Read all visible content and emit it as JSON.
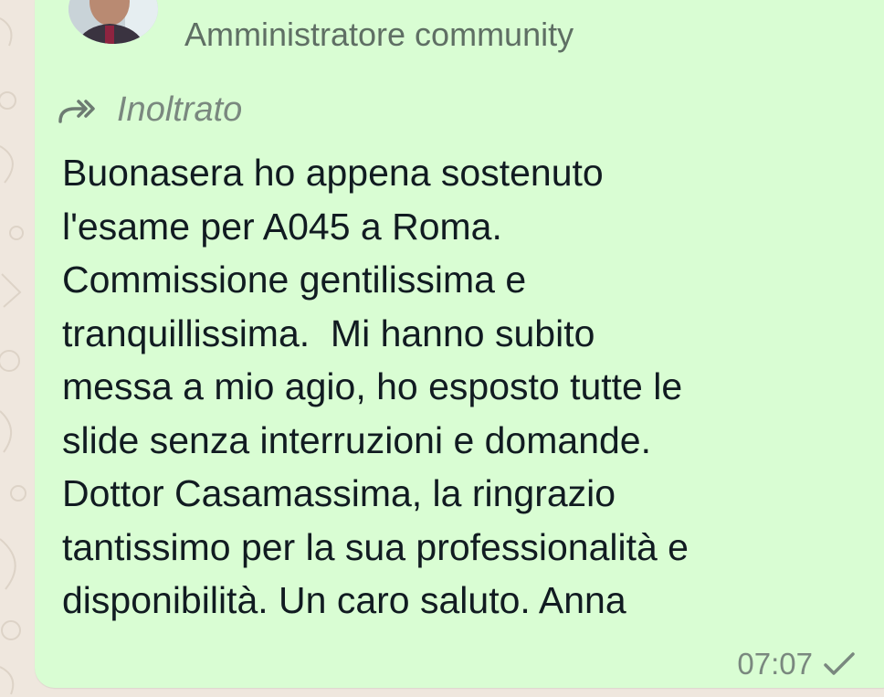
{
  "message": {
    "sender": "Amministratore community",
    "forwarded_label": "Inoltrato",
    "text_lines": [
      "Buonasera ho appena sostenuto",
      "l'esame per A045 a Roma.",
      "Commissione gentilissima e",
      "tranquillissima.  Mi hanno subito",
      "messa a mio agio, ho esposto tutte le",
      "slide senza interruzioni e domande.",
      "Dottor Casamassima, la ringrazio",
      "tantissimo per la sua professionalità e",
      "disponibilità. Un caro saluto. Anna"
    ],
    "time": "07:07",
    "status_icon": "single-check-icon"
  },
  "colors": {
    "bubble": "#d9fdd3",
    "background": "#efe7de",
    "text": "#111b21",
    "muted": "#7a887f"
  }
}
